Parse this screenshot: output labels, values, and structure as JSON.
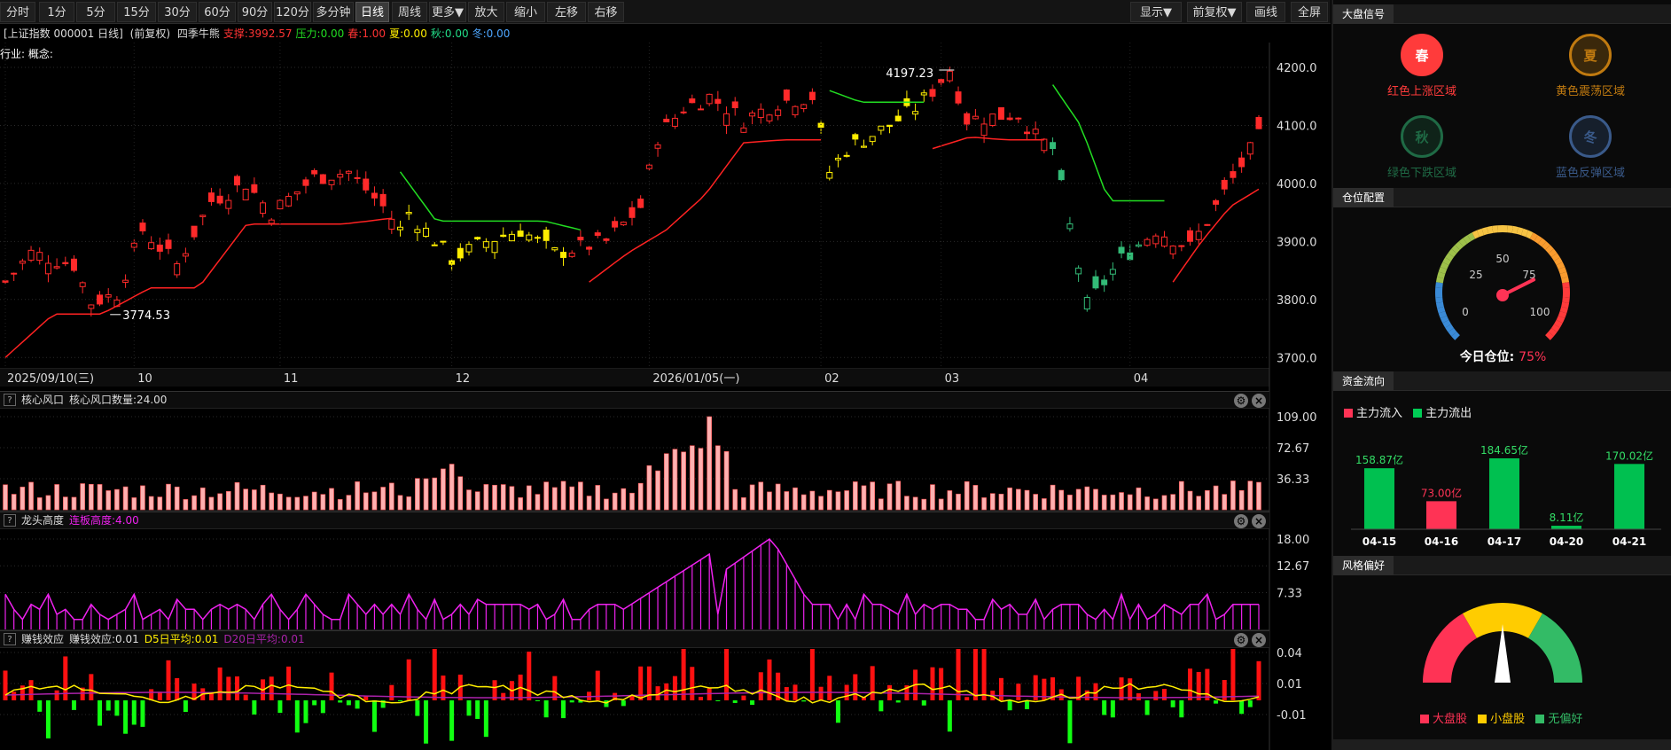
{
  "toolbar": {
    "left": [
      "分时",
      "1分",
      "5分",
      "15分",
      "30分",
      "60分",
      "90分",
      "120分",
      "多分钟",
      "日线",
      "周线",
      "更多▼",
      "放大",
      "缩小",
      "左移",
      "右移"
    ],
    "active": "日线",
    "right": [
      "显示▼",
      "前复权▼",
      "画线",
      "全屏"
    ]
  },
  "info": {
    "name": "[上证指数 000001 日线]",
    "adj": "(前复权)",
    "indicator": "四季牛熊",
    "support": "支撑:3992.57",
    "pressure": "压力:0.00",
    "spring": "春:1.00",
    "summer": "夏:0.00",
    "autumn": "秋:0.00",
    "winter": "冬:0.00",
    "industry": "行业: 概念:"
  },
  "main_chart": {
    "y_ticks": [
      "4200.0",
      "4100.0",
      "4000.0",
      "3900.0",
      "3800.0",
      "3700.0"
    ],
    "y_values": [
      4200,
      4100,
      4000,
      3900,
      3800,
      3700
    ],
    "high_label": "4197.23",
    "low_label": "3774.53",
    "x_labels": [
      {
        "text": "2025/09/10(三)",
        "i": 0
      },
      {
        "text": "10",
        "i": 15
      },
      {
        "text": "11",
        "i": 32
      },
      {
        "text": "12",
        "i": 52
      },
      {
        "text": "2026/01/05(一)",
        "i": 75
      },
      {
        "text": "02",
        "i": 95
      },
      {
        "text": "03",
        "i": 109
      },
      {
        "text": "04",
        "i": 131
      }
    ]
  },
  "panel1": {
    "name": "核心风口",
    "value_label": "核心风口数量:24.00",
    "y_ticks": [
      "109.00",
      "72.67",
      "36.33"
    ],
    "y_values": [
      109,
      72.67,
      36.33
    ]
  },
  "panel2": {
    "name": "龙头高度",
    "value_label": "连板高度:4.00",
    "y_ticks": [
      "18.00",
      "12.67",
      "7.33"
    ],
    "y_values": [
      18,
      12.67,
      7.33
    ]
  },
  "panel3": {
    "name": "赚钱效应",
    "value_label": "赚钱效应:0.01",
    "d5": "D5日平均:0.01",
    "d20": "D20日平均:0.01",
    "y_ticks": [
      "0.04",
      "0.01",
      "-0.01"
    ],
    "y_values": [
      0.04,
      0.01,
      -0.01
    ]
  },
  "sidebar": {
    "signal_title": "大盘信号",
    "seasons": [
      {
        "char": "春",
        "label": "红色上涨区域",
        "color": "#ff3b3b"
      },
      {
        "char": "夏",
        "label": "黄色震荡区域",
        "color": "#c07a10"
      },
      {
        "char": "秋",
        "label": "绿色下跌区域",
        "color": "#1f6a45"
      },
      {
        "char": "冬",
        "label": "蓝色反弹区域",
        "color": "#3a5a8a"
      }
    ],
    "position_title": "仓位配置",
    "gauge_ticks": [
      "0",
      "25",
      "50",
      "75",
      "100"
    ],
    "position_label": "今日仓位:",
    "position_value": "75%",
    "position_pct": 75,
    "flow_title": "资金流向",
    "flow_in_label": "主力流入",
    "flow_out_label": "主力流出",
    "flows": [
      {
        "date": "04-15",
        "value": 158.87,
        "label": "158.87亿",
        "dir": "out"
      },
      {
        "date": "04-16",
        "value": 73.0,
        "label": "73.00亿",
        "dir": "in"
      },
      {
        "date": "04-17",
        "value": 184.65,
        "label": "184.65亿",
        "dir": "out"
      },
      {
        "date": "04-20",
        "value": 8.11,
        "label": "8.11亿",
        "dir": "out"
      },
      {
        "date": "04-21",
        "value": 170.02,
        "label": "170.02亿",
        "dir": "out"
      }
    ],
    "style_title": "风格偏好",
    "style_legend": [
      "大盘股",
      "小盘股",
      "无偏好"
    ],
    "style_colors": [
      "#ff3355",
      "#ffcc00",
      "#33bb66"
    ]
  },
  "colors": {
    "up": "#ff3333",
    "down": "#00cc66",
    "spring": "#ff2a2a",
    "summer": "#ffee00",
    "autumn": "#33bb77",
    "pink": "#ffb0b0",
    "magenta": "#ee22ee",
    "support": "#ff2222",
    "pressure": "#22dd22"
  }
}
